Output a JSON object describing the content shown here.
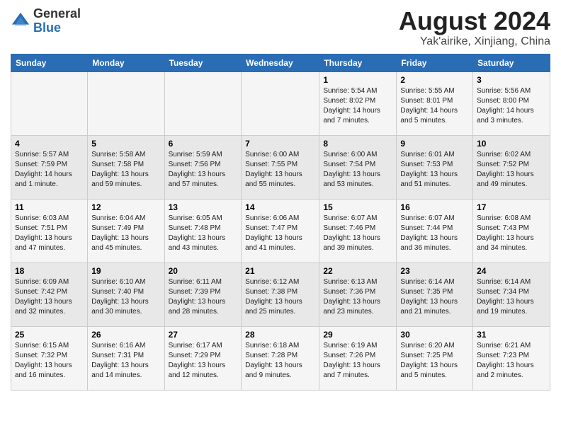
{
  "header": {
    "logo_general": "General",
    "logo_blue": "Blue",
    "month_title": "August 2024",
    "location": "Yak'airike, Xinjiang, China"
  },
  "days_of_week": [
    "Sunday",
    "Monday",
    "Tuesday",
    "Wednesday",
    "Thursday",
    "Friday",
    "Saturday"
  ],
  "weeks": [
    [
      {
        "day": "",
        "info": ""
      },
      {
        "day": "",
        "info": ""
      },
      {
        "day": "",
        "info": ""
      },
      {
        "day": "",
        "info": ""
      },
      {
        "day": "1",
        "info": "Sunrise: 5:54 AM\nSunset: 8:02 PM\nDaylight: 14 hours and 7 minutes."
      },
      {
        "day": "2",
        "info": "Sunrise: 5:55 AM\nSunset: 8:01 PM\nDaylight: 14 hours and 5 minutes."
      },
      {
        "day": "3",
        "info": "Sunrise: 5:56 AM\nSunset: 8:00 PM\nDaylight: 14 hours and 3 minutes."
      }
    ],
    [
      {
        "day": "4",
        "info": "Sunrise: 5:57 AM\nSunset: 7:59 PM\nDaylight: 14 hours and 1 minute."
      },
      {
        "day": "5",
        "info": "Sunrise: 5:58 AM\nSunset: 7:58 PM\nDaylight: 13 hours and 59 minutes."
      },
      {
        "day": "6",
        "info": "Sunrise: 5:59 AM\nSunset: 7:56 PM\nDaylight: 13 hours and 57 minutes."
      },
      {
        "day": "7",
        "info": "Sunrise: 6:00 AM\nSunset: 7:55 PM\nDaylight: 13 hours and 55 minutes."
      },
      {
        "day": "8",
        "info": "Sunrise: 6:00 AM\nSunset: 7:54 PM\nDaylight: 13 hours and 53 minutes."
      },
      {
        "day": "9",
        "info": "Sunrise: 6:01 AM\nSunset: 7:53 PM\nDaylight: 13 hours and 51 minutes."
      },
      {
        "day": "10",
        "info": "Sunrise: 6:02 AM\nSunset: 7:52 PM\nDaylight: 13 hours and 49 minutes."
      }
    ],
    [
      {
        "day": "11",
        "info": "Sunrise: 6:03 AM\nSunset: 7:51 PM\nDaylight: 13 hours and 47 minutes."
      },
      {
        "day": "12",
        "info": "Sunrise: 6:04 AM\nSunset: 7:49 PM\nDaylight: 13 hours and 45 minutes."
      },
      {
        "day": "13",
        "info": "Sunrise: 6:05 AM\nSunset: 7:48 PM\nDaylight: 13 hours and 43 minutes."
      },
      {
        "day": "14",
        "info": "Sunrise: 6:06 AM\nSunset: 7:47 PM\nDaylight: 13 hours and 41 minutes."
      },
      {
        "day": "15",
        "info": "Sunrise: 6:07 AM\nSunset: 7:46 PM\nDaylight: 13 hours and 39 minutes."
      },
      {
        "day": "16",
        "info": "Sunrise: 6:07 AM\nSunset: 7:44 PM\nDaylight: 13 hours and 36 minutes."
      },
      {
        "day": "17",
        "info": "Sunrise: 6:08 AM\nSunset: 7:43 PM\nDaylight: 13 hours and 34 minutes."
      }
    ],
    [
      {
        "day": "18",
        "info": "Sunrise: 6:09 AM\nSunset: 7:42 PM\nDaylight: 13 hours and 32 minutes."
      },
      {
        "day": "19",
        "info": "Sunrise: 6:10 AM\nSunset: 7:40 PM\nDaylight: 13 hours and 30 minutes."
      },
      {
        "day": "20",
        "info": "Sunrise: 6:11 AM\nSunset: 7:39 PM\nDaylight: 13 hours and 28 minutes."
      },
      {
        "day": "21",
        "info": "Sunrise: 6:12 AM\nSunset: 7:38 PM\nDaylight: 13 hours and 25 minutes."
      },
      {
        "day": "22",
        "info": "Sunrise: 6:13 AM\nSunset: 7:36 PM\nDaylight: 13 hours and 23 minutes."
      },
      {
        "day": "23",
        "info": "Sunrise: 6:14 AM\nSunset: 7:35 PM\nDaylight: 13 hours and 21 minutes."
      },
      {
        "day": "24",
        "info": "Sunrise: 6:14 AM\nSunset: 7:34 PM\nDaylight: 13 hours and 19 minutes."
      }
    ],
    [
      {
        "day": "25",
        "info": "Sunrise: 6:15 AM\nSunset: 7:32 PM\nDaylight: 13 hours and 16 minutes."
      },
      {
        "day": "26",
        "info": "Sunrise: 6:16 AM\nSunset: 7:31 PM\nDaylight: 13 hours and 14 minutes."
      },
      {
        "day": "27",
        "info": "Sunrise: 6:17 AM\nSunset: 7:29 PM\nDaylight: 13 hours and 12 minutes."
      },
      {
        "day": "28",
        "info": "Sunrise: 6:18 AM\nSunset: 7:28 PM\nDaylight: 13 hours and 9 minutes."
      },
      {
        "day": "29",
        "info": "Sunrise: 6:19 AM\nSunset: 7:26 PM\nDaylight: 13 hours and 7 minutes."
      },
      {
        "day": "30",
        "info": "Sunrise: 6:20 AM\nSunset: 7:25 PM\nDaylight: 13 hours and 5 minutes."
      },
      {
        "day": "31",
        "info": "Sunrise: 6:21 AM\nSunset: 7:23 PM\nDaylight: 13 hours and 2 minutes."
      }
    ]
  ]
}
